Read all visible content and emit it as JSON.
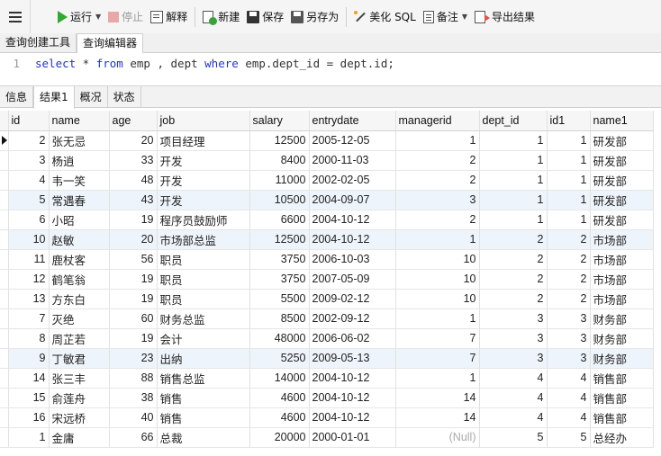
{
  "toolbar": {
    "run": "运行",
    "stop": "停止",
    "explain": "解释",
    "new": "新建",
    "save": "保存",
    "save_as": "另存为",
    "beautify": "美化 SQL",
    "notes": "备注",
    "export": "导出结果"
  },
  "query_tabs": [
    "查询创建工具",
    "查询编辑器"
  ],
  "editor": {
    "line_number": "1",
    "sql_parts": [
      "select",
      " * ",
      "from",
      " emp , dept ",
      "where",
      " emp.dept_id = dept.id;"
    ]
  },
  "result_tabs": [
    "信息",
    "结果1",
    "概况",
    "状态"
  ],
  "grid": {
    "columns": [
      "id",
      "name",
      "age",
      "job",
      "salary",
      "entrydate",
      "managerid",
      "dept_id",
      "id1",
      "name1"
    ],
    "rows": [
      [
        "2",
        "张无忌",
        "20",
        "项目经理",
        "12500",
        "2005-12-05",
        "1",
        "1",
        "1",
        "研发部"
      ],
      [
        "3",
        "杨逍",
        "33",
        "开发",
        "8400",
        "2000-11-03",
        "2",
        "1",
        "1",
        "研发部"
      ],
      [
        "4",
        "韦一笑",
        "48",
        "开发",
        "11000",
        "2002-02-05",
        "2",
        "1",
        "1",
        "研发部"
      ],
      [
        "5",
        "常遇春",
        "43",
        "开发",
        "10500",
        "2004-09-07",
        "3",
        "1",
        "1",
        "研发部"
      ],
      [
        "6",
        "小昭",
        "19",
        "程序员鼓励师",
        "6600",
        "2004-10-12",
        "2",
        "1",
        "1",
        "研发部"
      ],
      [
        "10",
        "赵敏",
        "20",
        "市场部总监",
        "12500",
        "2004-10-12",
        "1",
        "2",
        "2",
        "市场部"
      ],
      [
        "11",
        "鹿杖客",
        "56",
        "职员",
        "3750",
        "2006-10-03",
        "10",
        "2",
        "2",
        "市场部"
      ],
      [
        "12",
        "鹤笔翁",
        "19",
        "职员",
        "3750",
        "2007-05-09",
        "10",
        "2",
        "2",
        "市场部"
      ],
      [
        "13",
        "方东白",
        "19",
        "职员",
        "5500",
        "2009-02-12",
        "10",
        "2",
        "2",
        "市场部"
      ],
      [
        "7",
        "灭绝",
        "60",
        "财务总监",
        "8500",
        "2002-09-12",
        "1",
        "3",
        "3",
        "财务部"
      ],
      [
        "8",
        "周芷若",
        "19",
        "会计",
        "48000",
        "2006-06-02",
        "7",
        "3",
        "3",
        "财务部"
      ],
      [
        "9",
        "丁敏君",
        "23",
        "出纳",
        "5250",
        "2009-05-13",
        "7",
        "3",
        "3",
        "财务部"
      ],
      [
        "14",
        "张三丰",
        "88",
        "销售总监",
        "14000",
        "2004-10-12",
        "1",
        "4",
        "4",
        "销售部"
      ],
      [
        "15",
        "俞莲舟",
        "38",
        "销售",
        "4600",
        "2004-10-12",
        "14",
        "4",
        "4",
        "销售部"
      ],
      [
        "16",
        "宋远桥",
        "40",
        "销售",
        "4600",
        "2004-10-12",
        "14",
        "4",
        "4",
        "销售部"
      ],
      [
        "1",
        "金庸",
        "66",
        "总裁",
        "20000",
        "2000-01-01",
        "(Null)",
        "5",
        "5",
        "总经办"
      ]
    ]
  }
}
